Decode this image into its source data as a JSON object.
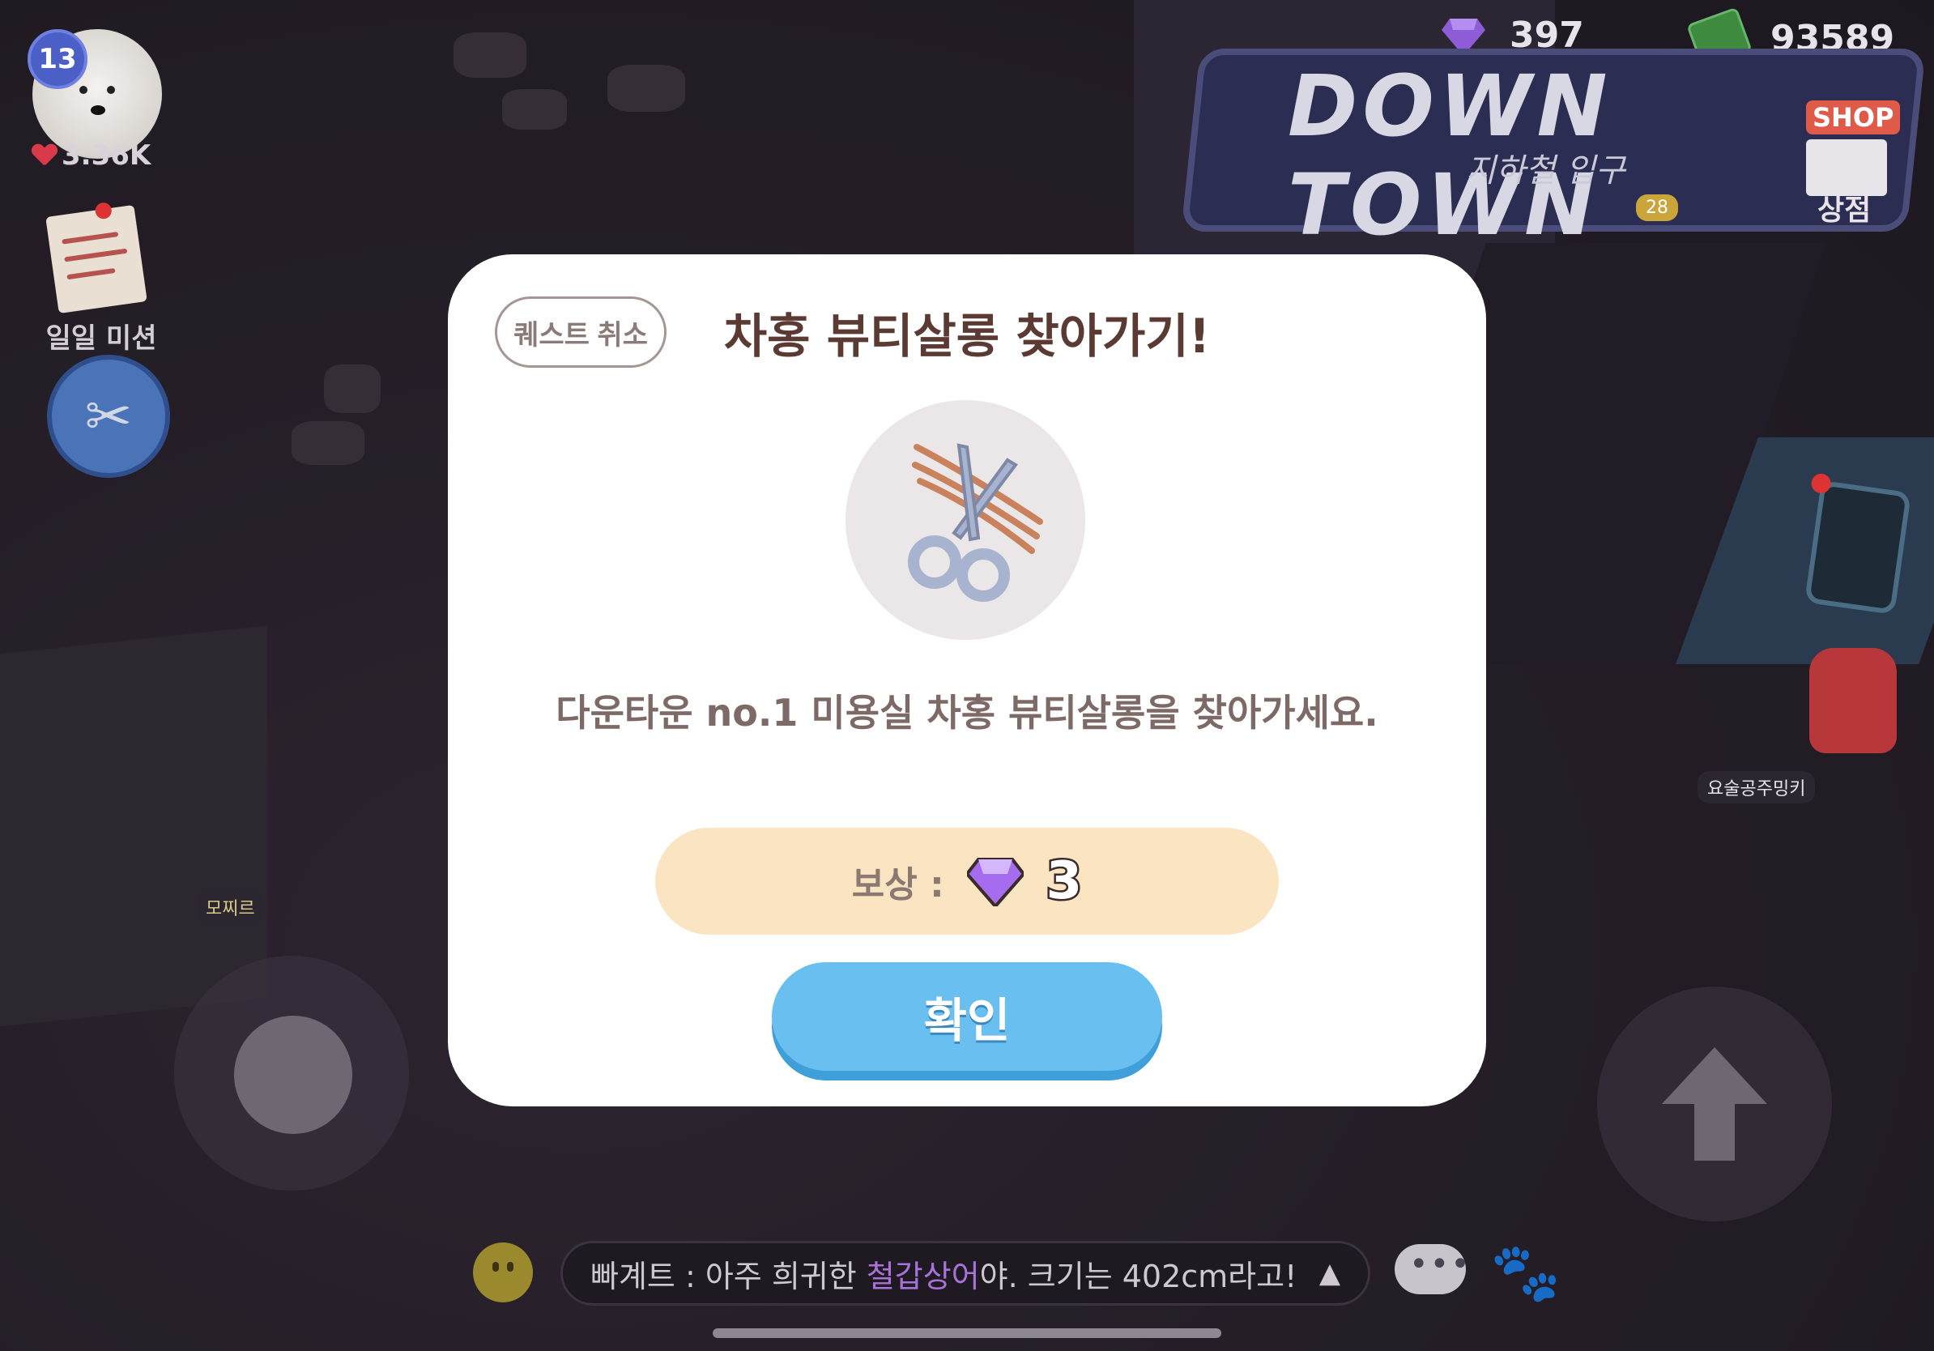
{
  "player": {
    "level": "13",
    "likes": "3.36K"
  },
  "hud": {
    "daily_mission_label": "일일 미션",
    "gems": "397",
    "cash": "93589",
    "location_title": "DOWN TOWN",
    "location_subtitle": "지하철 입구",
    "shop_tag": "SHOP",
    "shop_label": "상점",
    "npc_level": "28"
  },
  "modal": {
    "cancel_label": "퀘스트 취소",
    "title": "차홍 뷰티살롱 찾아가기!",
    "quest_icon": "scissors-icon",
    "description": "다운타운 no.1 미용실 차홍 뷰티살롱을 찾아가세요.",
    "reward_label": "보상 :",
    "reward_icon": "gem-icon",
    "reward_count": "3",
    "confirm_label": "확인"
  },
  "chat": {
    "speaker": "빠계트",
    "prefix": " : 아주 희귀한 ",
    "highlight": "철갑상어",
    "suffix": "야. 크기는 402cm라고!",
    "expand_icon": "triangle-up-icon"
  },
  "nametags": {
    "left_player": "모찌르",
    "right_player": "요술공주밍키"
  },
  "colors": {
    "confirm_blue": "#69bff0",
    "reward_bg": "#fbe4c2",
    "title_brown": "#5b3a33",
    "chat_highlight": "#a873d8",
    "gem_purple": "#a56cf0"
  }
}
